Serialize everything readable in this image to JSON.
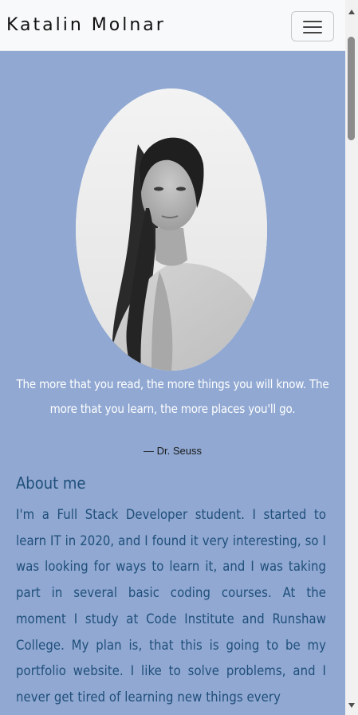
{
  "navbar": {
    "brand": "Katalin Molnar",
    "toggle_icon": "hamburger-menu-icon"
  },
  "hero": {
    "photo_alt": "Portrait of Katalin Molnar",
    "quote": "The more that you read, the more things you will know. The more that you learn, the more places you'll go.",
    "attribution": "— Dr. Seuss"
  },
  "about": {
    "heading": "About me",
    "text": "I'm a Full Stack Developer student. I started to learn IT in 2020, and I found it very interesting, so I was looking for ways to learn it, and I was taking part in several basic coding courses. At the moment I study at Code Institute and Runshaw College. My plan is, that this is going to be my portfolio website. I like to solve problems, and I never get tired of learning new things every"
  },
  "colors": {
    "page_background": "#90a8d2",
    "navbar_background": "#f8f9fa",
    "heading_color": "#1f4f7a",
    "quote_color": "#ffffff"
  }
}
